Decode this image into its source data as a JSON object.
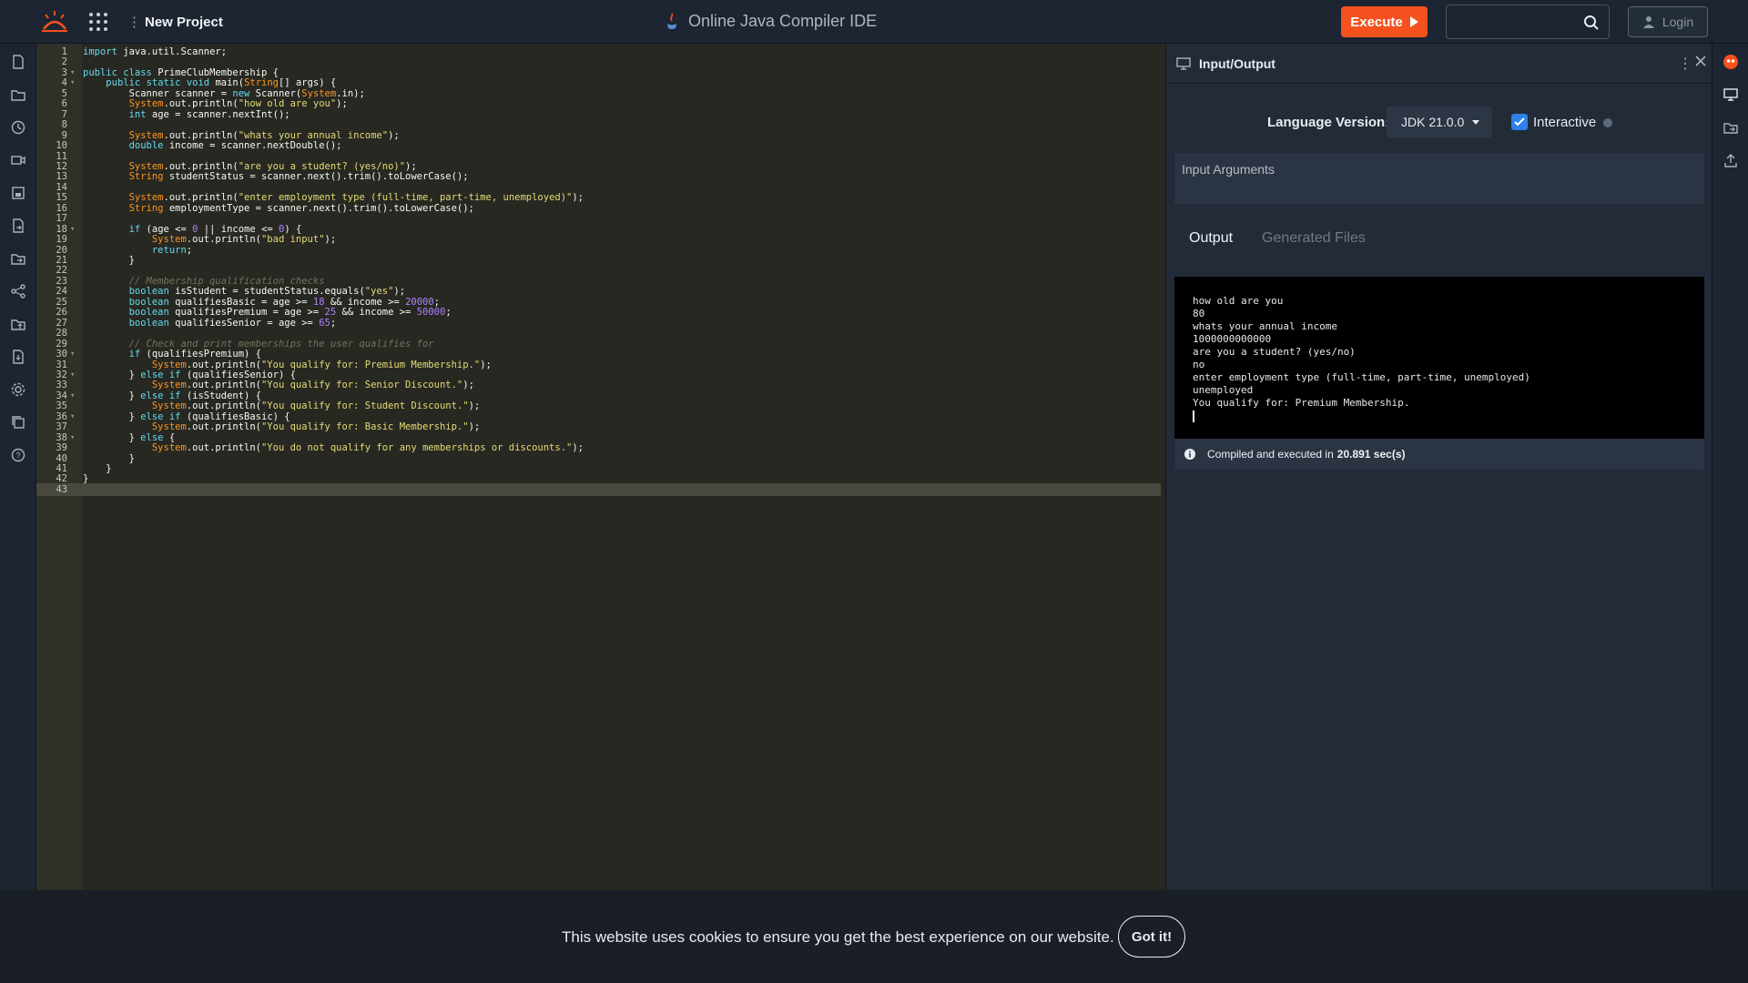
{
  "header": {
    "project_name": "New Project",
    "app_title": "Online Java Compiler IDE",
    "execute_label": "Execute",
    "search_placeholder": "",
    "login_label": "Login"
  },
  "left_sidebar_icons": [
    "new-file-icon",
    "folder-open-icon",
    "history-icon",
    "video-icon",
    "save-icon",
    "save-as-icon",
    "save-templates-icon",
    "share-icon",
    "open-from-local-icon",
    "download-icon",
    "settings-icon",
    "copy-icon",
    "help-icon"
  ],
  "right_sidebar_icons": [
    "jdoodle-bot-icon",
    "input-output-icon",
    "libraries-icon",
    "upload-icon"
  ],
  "editor": {
    "active_line": 43,
    "lines": [
      {
        "n": "1",
        "fold": false,
        "html": "<span class='kw'>import</span> java.util.Scanner;"
      },
      {
        "n": "2",
        "fold": false,
        "html": ""
      },
      {
        "n": "3",
        "fold": true,
        "html": "<span class='kw'>public</span> <span class='kw'>class</span> PrimeClubMembership {"
      },
      {
        "n": "4",
        "fold": true,
        "html": "    <span class='kw'>public</span> <span class='kw'>static</span> <span class='kw'>void</span> main(<span class='ty'>String</span>[] args) {"
      },
      {
        "n": "5",
        "fold": false,
        "html": "        Scanner scanner = <span class='kw'>new</span> Scanner(<span class='ty'>System</span>.in);"
      },
      {
        "n": "6",
        "fold": false,
        "html": "        <span class='ty'>System</span>.out.println(<span class='st'>\"how old are you\"</span>);"
      },
      {
        "n": "7",
        "fold": false,
        "html": "        <span class='kw'>int</span> age = scanner.nextInt();"
      },
      {
        "n": "8",
        "fold": false,
        "html": ""
      },
      {
        "n": "9",
        "fold": false,
        "html": "        <span class='ty'>System</span>.out.println(<span class='st'>\"whats your annual income\"</span>);"
      },
      {
        "n": "10",
        "fold": false,
        "html": "        <span class='kw'>double</span> income = scanner.nextDouble();"
      },
      {
        "n": "11",
        "fold": false,
        "html": ""
      },
      {
        "n": "12",
        "fold": false,
        "html": "        <span class='ty'>System</span>.out.println(<span class='st'>\"are you a student? (yes/no)\"</span>);"
      },
      {
        "n": "13",
        "fold": false,
        "html": "        <span class='ty'>String</span> studentStatus = scanner.next().trim().toLowerCase();"
      },
      {
        "n": "14",
        "fold": false,
        "html": ""
      },
      {
        "n": "15",
        "fold": false,
        "html": "        <span class='ty'>System</span>.out.println(<span class='st'>\"enter employment type (full-time, part-time, unemployed)\"</span>);"
      },
      {
        "n": "16",
        "fold": false,
        "html": "        <span class='ty'>String</span> employmentType = scanner.next().trim().toLowerCase();"
      },
      {
        "n": "17",
        "fold": false,
        "html": ""
      },
      {
        "n": "18",
        "fold": true,
        "html": "        <span class='kw'>if</span> (age &lt;= <span class='nm'>0</span> || income &lt;= <span class='nm'>0</span>) {"
      },
      {
        "n": "19",
        "fold": false,
        "html": "            <span class='ty'>System</span>.out.println(<span class='st'>\"bad input\"</span>);"
      },
      {
        "n": "20",
        "fold": false,
        "html": "            <span class='kw'>return</span>;"
      },
      {
        "n": "21",
        "fold": false,
        "html": "        }"
      },
      {
        "n": "22",
        "fold": false,
        "html": ""
      },
      {
        "n": "23",
        "fold": false,
        "html": "        <span class='cm'>// Membership qualification checks</span>"
      },
      {
        "n": "24",
        "fold": false,
        "html": "        <span class='kw'>boolean</span> isStudent = studentStatus.equals(<span class='st'>\"yes\"</span>);"
      },
      {
        "n": "25",
        "fold": false,
        "html": "        <span class='kw'>boolean</span> qualifiesBasic = age &gt;= <span class='nm'>18</span> &amp;&amp; income &gt;= <span class='nm'>20000</span>;"
      },
      {
        "n": "26",
        "fold": false,
        "html": "        <span class='kw'>boolean</span> qualifiesPremium = age &gt;= <span class='nm'>25</span> &amp;&amp; income &gt;= <span class='nm'>50000</span>;"
      },
      {
        "n": "27",
        "fold": false,
        "html": "        <span class='kw'>boolean</span> qualifiesSenior = age &gt;= <span class='nm'>65</span>;"
      },
      {
        "n": "28",
        "fold": false,
        "html": ""
      },
      {
        "n": "29",
        "fold": false,
        "html": "        <span class='cm'>// Check and print memberships the user qualifies for</span>"
      },
      {
        "n": "30",
        "fold": true,
        "html": "        <span class='kw'>if</span> (qualifiesPremium) {"
      },
      {
        "n": "31",
        "fold": false,
        "html": "            <span class='ty'>System</span>.out.println(<span class='st'>\"You qualify for: Premium Membership.\"</span>);"
      },
      {
        "n": "32",
        "fold": true,
        "html": "        } <span class='kw'>else</span> <span class='kw'>if</span> (qualifiesSenior) {"
      },
      {
        "n": "33",
        "fold": false,
        "html": "            <span class='ty'>System</span>.out.println(<span class='st'>\"You qualify for: Senior Discount.\"</span>);"
      },
      {
        "n": "34",
        "fold": true,
        "html": "        } <span class='kw'>else</span> <span class='kw'>if</span> (isStudent) {"
      },
      {
        "n": "35",
        "fold": false,
        "html": "            <span class='ty'>System</span>.out.println(<span class='st'>\"You qualify for: Student Discount.\"</span>);"
      },
      {
        "n": "36",
        "fold": true,
        "html": "        } <span class='kw'>else</span> <span class='kw'>if</span> (qualifiesBasic) {"
      },
      {
        "n": "37",
        "fold": false,
        "html": "            <span class='ty'>System</span>.out.println(<span class='st'>\"You qualify for: Basic Membership.\"</span>);"
      },
      {
        "n": "38",
        "fold": true,
        "html": "        } <span class='kw'>else</span> {"
      },
      {
        "n": "39",
        "fold": false,
        "html": "            <span class='ty'>System</span>.out.println(<span class='st'>\"You do not qualify for any memberships or discounts.\"</span>);"
      },
      {
        "n": "40",
        "fold": false,
        "html": "        }"
      },
      {
        "n": "41",
        "fold": false,
        "html": "    }"
      },
      {
        "n": "42",
        "fold": false,
        "html": "}"
      },
      {
        "n": "43",
        "fold": false,
        "html": ""
      }
    ]
  },
  "io_panel": {
    "title": "Input/Output",
    "language_label": "Language Version:",
    "language_value": "JDK 21.0.0",
    "interactive_label": "Interactive",
    "interactive_checked": true,
    "args_placeholder": "Input Arguments",
    "tab_output": "Output",
    "tab_files": "Generated Files",
    "console_lines": [
      "how old are you",
      "80",
      "whats your annual income",
      "1000000000000",
      "are you a student? (yes/no)",
      "no",
      "enter employment type (full-time, part-time, unemployed)",
      "unemployed",
      "You qualify for: Premium Membership."
    ],
    "status_prefix": "Compiled and executed in",
    "status_time": "20.891 sec(s)"
  },
  "cookie": {
    "text": "This website uses cookies to ensure you get the best experience on our website.",
    "button": "Got it!"
  },
  "colors": {
    "accent": "#f4511e",
    "checkbox": "#2d82e8",
    "editor_bg": "#272822"
  }
}
